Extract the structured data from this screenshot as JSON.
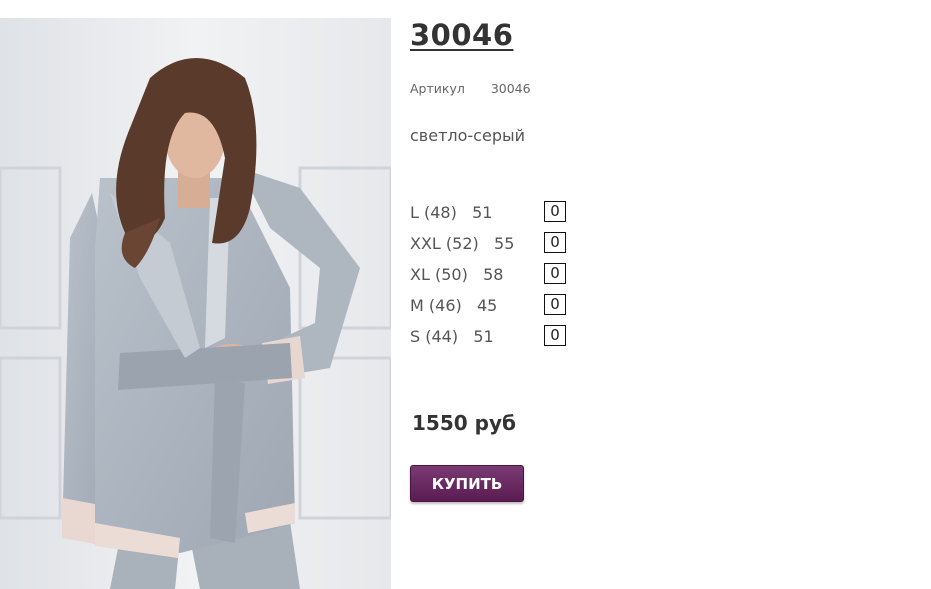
{
  "product": {
    "title": "30046",
    "sku_label": "Артикул",
    "sku_value": "30046",
    "color_name": "светло-серый",
    "sizes": [
      {
        "label": "L (48)   51",
        "qty": "0"
      },
      {
        "label": "XXL (52)   55",
        "qty": "0"
      },
      {
        "label": "XL (50)   58",
        "qty": "0"
      },
      {
        "label": "M (46)   45",
        "qty": "0"
      },
      {
        "label": "S (44)   51",
        "qty": "0"
      }
    ],
    "price": "1550 руб",
    "buy_label": "КУПИТЬ"
  },
  "colors": {
    "button": "#6a2860",
    "title": "#333333",
    "text": "#555555"
  }
}
